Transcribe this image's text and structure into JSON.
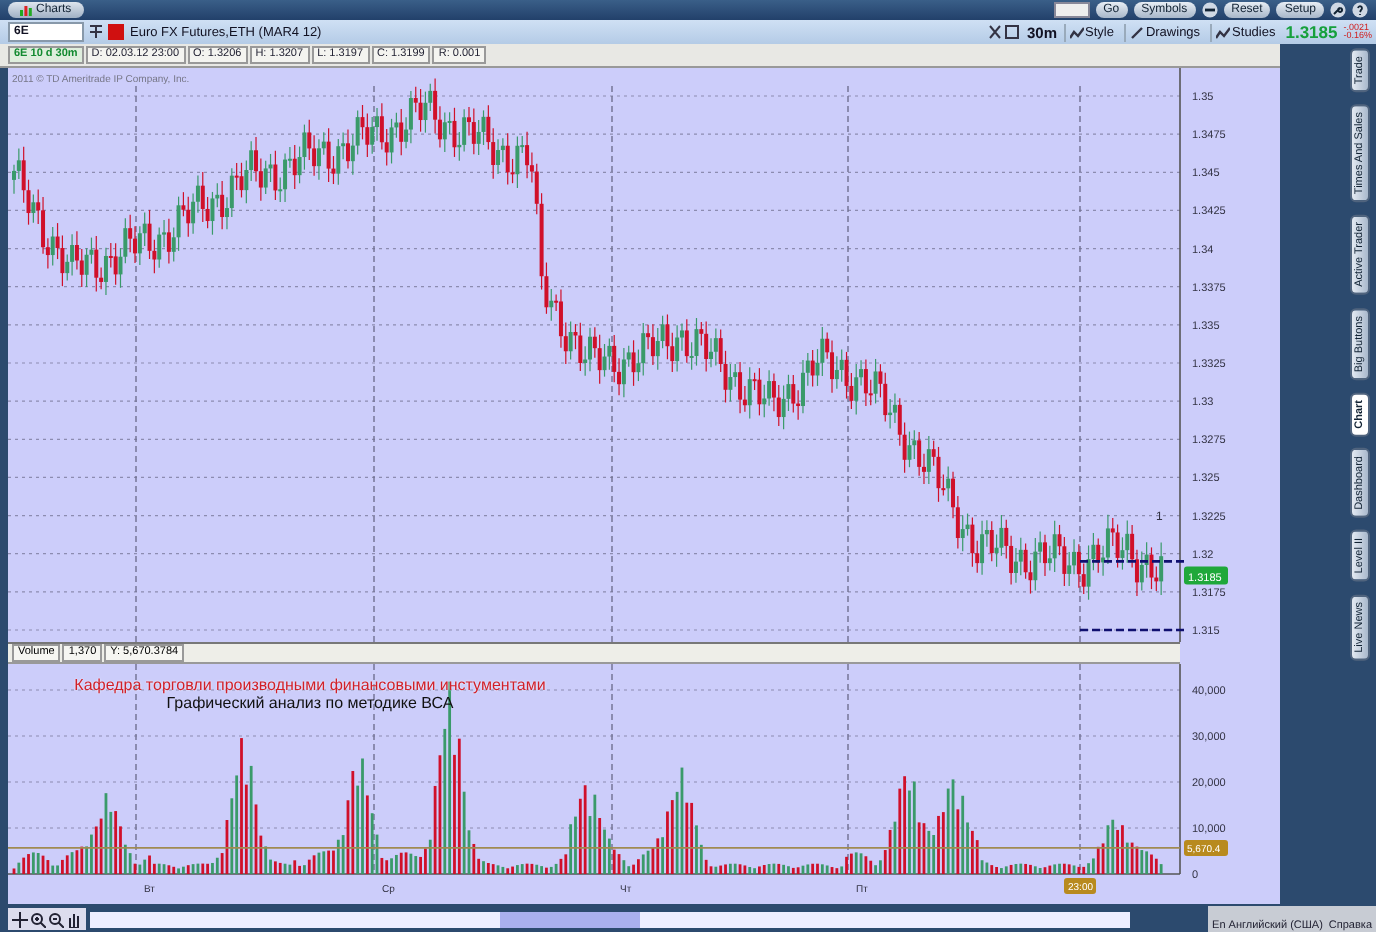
{
  "app_bar": {
    "tab": "Charts",
    "buttons": [
      "Go",
      "Symbols",
      "Reset",
      "Setup"
    ]
  },
  "symbol_bar": {
    "symbol": "6E",
    "description": "Euro FX Futures,ETH (MAR4 12)"
  },
  "chart_toolbar": {
    "timeframe": "30m",
    "buttons": [
      "Style",
      "Drawings",
      "Studies"
    ],
    "last_price": "1.3185",
    "change": "-.0021",
    "change_percent": "-0.16%"
  },
  "info_strip": [
    {
      "text": "6E 10 d 30m",
      "kind": "symbol"
    },
    {
      "text": "D: 02.03.12 23:00",
      "kind": "plain"
    },
    {
      "text": "O: 1.3206",
      "kind": "plain"
    },
    {
      "text": "H: 1.3207",
      "kind": "plain"
    },
    {
      "text": "L: 1.3197",
      "kind": "plain"
    },
    {
      "text": "C: 1.3199",
      "kind": "plain"
    },
    {
      "text": "R: 0.001",
      "kind": "plain"
    }
  ],
  "price_pane": {
    "copyright": "2011 © TD Ameritrade IP Company, Inc.",
    "axis_labels": [
      "1.35",
      "1.3475",
      "1.345",
      "1.3425",
      "1.34",
      "1.3375",
      "1.335",
      "1.3325",
      "1.33",
      "1.3275",
      "1.325",
      "1.3225",
      "1.32",
      "1.3175",
      "1.315"
    ],
    "current_price_label": "1.3185",
    "marker": "1"
  },
  "volume_pane": {
    "header": [
      "Volume",
      "1,370",
      "Y: 5,670.3784"
    ],
    "axis_labels": [
      "40,000",
      "30,000",
      "20,000",
      "10,000",
      "0"
    ],
    "average_label": "5,670.4",
    "overlay_title": "Кафедра торговли производными финансовыми инстументами",
    "overlay_subtitle": "Графический анализ по методике ВСА"
  },
  "time_axis": {
    "labels": [
      "Вт",
      "Ср",
      "Чт",
      "Пт"
    ],
    "cursor_label": "23:00"
  },
  "side_panel": {
    "tabs": [
      {
        "label": "Trade",
        "selected": false
      },
      {
        "label": "Times And Sales",
        "selected": false
      },
      {
        "label": "Active Trader",
        "selected": false
      },
      {
        "label": "Big Buttons",
        "selected": false
      },
      {
        "label": "Chart",
        "selected": true
      },
      {
        "label": "Dashboard",
        "selected": false
      },
      {
        "label": "Level II",
        "selected": false
      },
      {
        "label": "Live News",
        "selected": false
      }
    ]
  },
  "status_bar": {
    "language": "En Английский (США)",
    "help": "Справка"
  }
}
